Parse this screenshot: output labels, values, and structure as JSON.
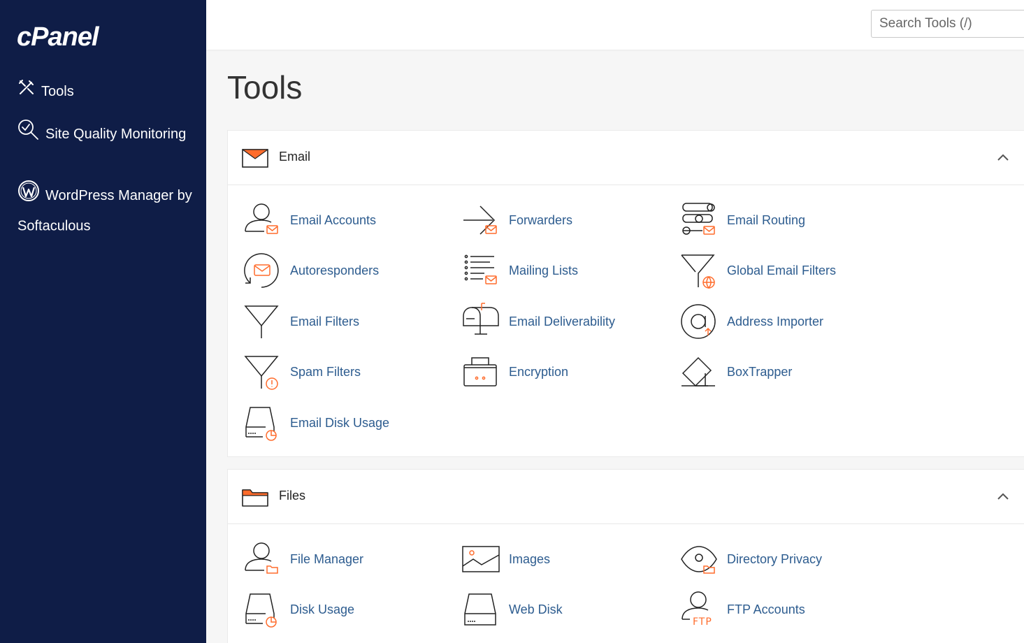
{
  "brand": {
    "logo_text": "cPanel"
  },
  "sidebar": {
    "items": [
      {
        "label": "Tools",
        "icon": "tools-icon"
      },
      {
        "label": "Site Quality Monitoring",
        "icon": "magnifier-check-icon"
      },
      {
        "label": "WordPress Manager by Softaculous",
        "icon": "wordpress-icon"
      }
    ]
  },
  "search": {
    "placeholder": "Search Tools (/)"
  },
  "page": {
    "title": "Tools"
  },
  "sections": [
    {
      "title": "Email",
      "icon": "envelope-icon",
      "items": [
        {
          "label": "Email Accounts",
          "icon": "user-mail-icon"
        },
        {
          "label": "Forwarders",
          "icon": "forward-arrow-icon"
        },
        {
          "label": "Email Routing",
          "icon": "routing-icon"
        },
        {
          "label": "Autoresponders",
          "icon": "autoresponder-icon"
        },
        {
          "label": "Mailing Lists",
          "icon": "list-mail-icon"
        },
        {
          "label": "Global Email Filters",
          "icon": "funnel-globe-icon"
        },
        {
          "label": "Email Filters",
          "icon": "funnel-icon"
        },
        {
          "label": "Email Deliverability",
          "icon": "mailbox-icon"
        },
        {
          "label": "Address Importer",
          "icon": "at-sign-icon"
        },
        {
          "label": "Spam Filters",
          "icon": "funnel-warning-icon"
        },
        {
          "label": "Encryption",
          "icon": "briefcase-lock-icon"
        },
        {
          "label": "BoxTrapper",
          "icon": "box-trap-icon"
        },
        {
          "label": "Email Disk Usage",
          "icon": "disk-chart-icon"
        }
      ]
    },
    {
      "title": "Files",
      "icon": "folder-icon",
      "items": [
        {
          "label": "File Manager",
          "icon": "user-folder-icon"
        },
        {
          "label": "Images",
          "icon": "image-icon"
        },
        {
          "label": "Directory Privacy",
          "icon": "eye-folder-icon"
        },
        {
          "label": "Disk Usage",
          "icon": "disk-chart-icon"
        },
        {
          "label": "Web Disk",
          "icon": "drive-icon"
        },
        {
          "label": "FTP Accounts",
          "icon": "user-ftp-icon"
        }
      ]
    }
  ],
  "colors": {
    "sidebar_bg": "#0f1d47",
    "accent": "#ff6c2c",
    "link": "#2d5c8f"
  }
}
